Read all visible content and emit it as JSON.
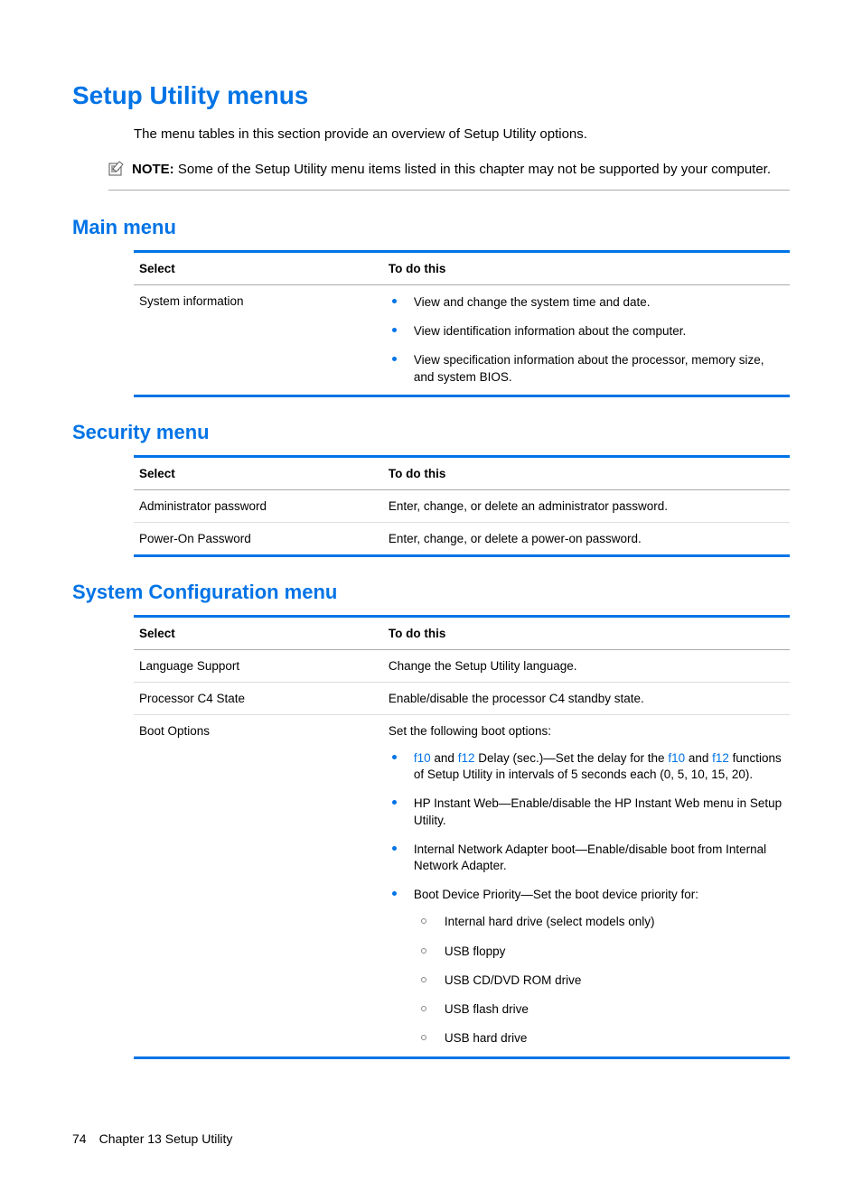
{
  "title": "Setup Utility menus",
  "intro": "The menu tables in this section provide an overview of Setup Utility options.",
  "note": {
    "label": "NOTE:",
    "text": "Some of the Setup Utility menu items listed in this chapter may not be supported by your computer."
  },
  "headers": {
    "select": "Select",
    "todo": "To do this"
  },
  "main": {
    "heading": "Main menu",
    "rows": [
      {
        "select": "System information",
        "bullets": [
          "View and change the system time and date.",
          "View identification information about the computer.",
          "View specification information about the processor, memory size, and system BIOS."
        ]
      }
    ]
  },
  "security": {
    "heading": "Security menu",
    "rows": [
      {
        "select": "Administrator password",
        "todo": "Enter, change, or delete an administrator password."
      },
      {
        "select": "Power-On Password",
        "todo": "Enter, change, or delete a power-on password."
      }
    ]
  },
  "sysconfig": {
    "heading": "System Configuration menu",
    "rows": [
      {
        "select": "Language Support",
        "todo": "Change the Setup Utility language."
      },
      {
        "select": "Processor C4 State",
        "todo": "Enable/disable the processor C4 standby state."
      },
      {
        "select": "Boot Options",
        "lead": "Set the following boot options:",
        "keys": {
          "f10": "f10",
          "f12": "f12"
        },
        "b1_delay_mid": " Delay (sec.)—Set the delay for the ",
        "b1_delay_tail": " functions of Setup Utility in intervals of 5 seconds each (0, 5, 10, 15, 20).",
        "and": " and ",
        "b2": "HP Instant Web—Enable/disable the HP Instant Web menu in Setup Utility.",
        "b3": "Internal Network Adapter boot—Enable/disable boot from Internal Network Adapter.",
        "b4": "Boot Device Priority—Set the boot device priority for:",
        "sub": [
          "Internal hard drive (select models only)",
          "USB floppy",
          "USB CD/DVD ROM drive",
          "USB flash drive",
          "USB hard drive"
        ]
      }
    ]
  },
  "footer": {
    "page": "74",
    "chapter": "Chapter 13   Setup Utility"
  }
}
